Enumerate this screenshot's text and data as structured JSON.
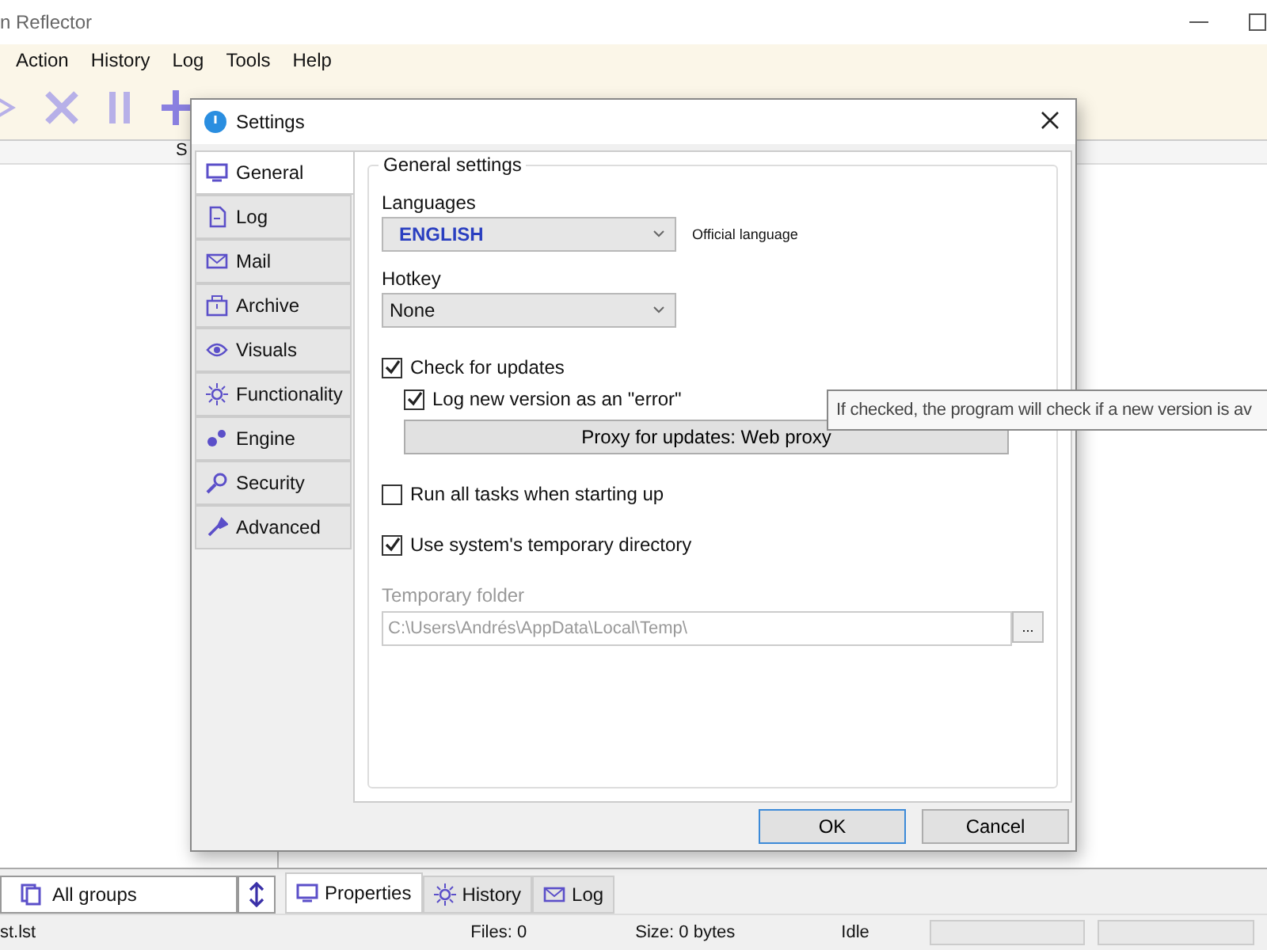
{
  "window": {
    "title": "n Reflector"
  },
  "menu": [
    "Action",
    "History",
    "Log",
    "Tools",
    "Help"
  ],
  "group_selector": {
    "value": "All groups"
  },
  "column_header": "S",
  "bottom_tabs": [
    {
      "label": "Properties",
      "selected": true
    },
    {
      "label": "History",
      "selected": false
    },
    {
      "label": "Log",
      "selected": false
    }
  ],
  "status_bar": {
    "file": "st.lst",
    "files": "Files: 0",
    "size": "Size: 0 bytes",
    "state": "Idle"
  },
  "dialog": {
    "title": "Settings",
    "tabs": [
      {
        "label": "General",
        "selected": true
      },
      {
        "label": "Log",
        "selected": false
      },
      {
        "label": "Mail",
        "selected": false
      },
      {
        "label": "Archive",
        "selected": false
      },
      {
        "label": "Visuals",
        "selected": false
      },
      {
        "label": "Functionality",
        "selected": false
      },
      {
        "label": "Engine",
        "selected": false
      },
      {
        "label": "Security",
        "selected": false
      },
      {
        "label": "Advanced",
        "selected": false
      }
    ],
    "group_title": "General settings",
    "language": {
      "label": "Languages",
      "value": "ENGLISH",
      "note": "Official language"
    },
    "hotkey": {
      "label": "Hotkey",
      "value": "None"
    },
    "options": [
      {
        "kind": "checkbox",
        "label": "Check for updates",
        "checked": true,
        "children": [
          {
            "kind": "checkbox",
            "label": "Log new version as an \"error\"",
            "checked": true
          },
          {
            "kind": "button",
            "label": "Proxy for updates: Web proxy"
          }
        ]
      },
      {
        "kind": "checkbox",
        "label": "Run all tasks when starting up",
        "checked": false
      },
      {
        "kind": "checkbox",
        "label": "Use system's temporary directory",
        "checked": true
      }
    ],
    "temp_folder": {
      "label": "Temporary folder",
      "value": "C:\\Users\\Andrés\\AppData\\Local\\Temp\\",
      "disabled": true,
      "browse": "..."
    },
    "buttons": [
      {
        "label": "OK",
        "default": true
      },
      {
        "label": "Cancel",
        "default": false
      }
    ]
  },
  "tooltip": "If checked, the program will check if a new version is av"
}
